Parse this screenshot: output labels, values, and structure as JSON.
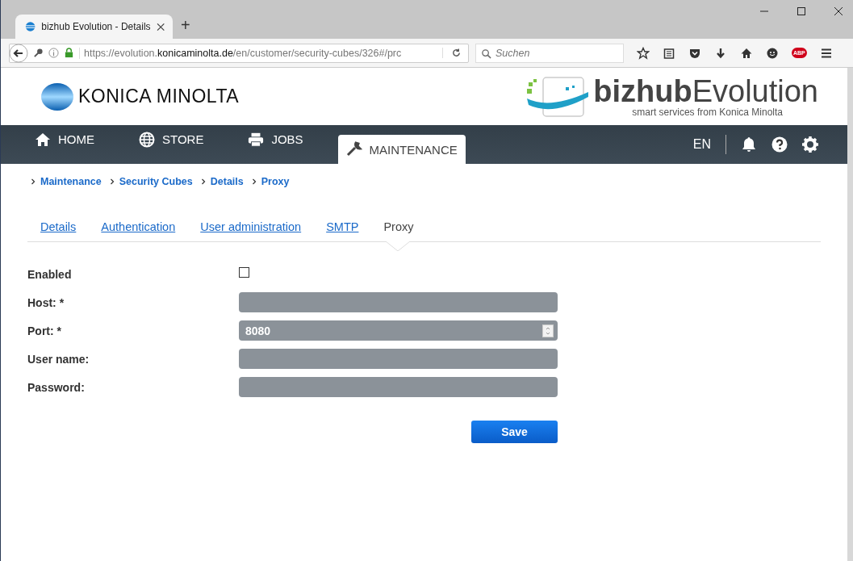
{
  "browser": {
    "tab_title": "bizhub Evolution - Details",
    "new_tab": "+",
    "url": {
      "scheme_host": "https://evolution.",
      "domain": "konicaminolta.de",
      "path": "/en/customer/security-cubes/326#/prc"
    },
    "search": {
      "placeholder": "Suchen"
    },
    "abp": "ABP"
  },
  "header": {
    "brand": "KONICA MINOLTA",
    "product_bold": "bizhub",
    "product_light": "Evolution",
    "tagline": "smart services from Konica Minolta"
  },
  "nav": {
    "items": [
      {
        "label": "HOME",
        "selected": false
      },
      {
        "label": "STORE",
        "selected": false
      },
      {
        "label": "JOBS",
        "selected": false
      },
      {
        "label": "MAINTENANCE",
        "selected": true
      }
    ],
    "language": "EN"
  },
  "breadcrumb": [
    "Maintenance",
    "Security Cubes",
    "Details",
    "Proxy"
  ],
  "tabs": [
    {
      "label": "Details",
      "selected": false
    },
    {
      "label": "Authentication",
      "selected": false
    },
    {
      "label": "User administration",
      "selected": false
    },
    {
      "label": "SMTP",
      "selected": false
    },
    {
      "label": "Proxy",
      "selected": true
    }
  ],
  "form": [
    {
      "kind": "checkbox",
      "label": "Enabled",
      "checked": false
    },
    {
      "kind": "text",
      "label": "Host: *"
    },
    {
      "kind": "number",
      "label": "Port: *",
      "value": "8080"
    },
    {
      "kind": "text",
      "label": "User name:"
    },
    {
      "kind": "password",
      "label": "Password:"
    }
  ],
  "save_button": "Save"
}
